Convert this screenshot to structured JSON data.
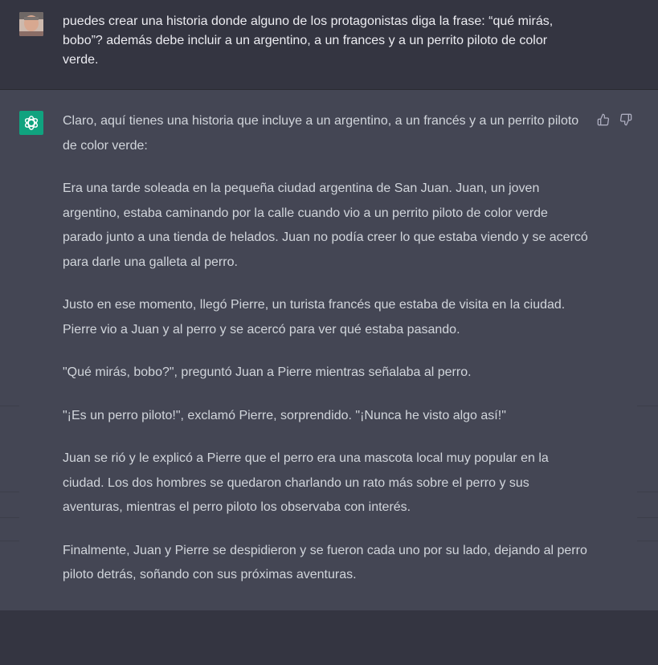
{
  "user_message": {
    "avatar_icon": "user-photo",
    "text": "puedes crear una historia donde alguno de los protagonistas diga la frase: “qué mirás, bobo”? además debe incluir a un argentino, a un frances y a un perrito piloto de color verde."
  },
  "assistant_message": {
    "avatar_icon": "openai-logo",
    "avatar_color": "#10a37f",
    "paragraphs": [
      "Claro, aquí tienes una historia que incluye a un argentino, a un francés y a un perrito piloto de color verde:",
      "Era una tarde soleada en la pequeña ciudad argentina de San Juan. Juan, un joven argentino, estaba caminando por la calle cuando vio a un perrito piloto de color verde parado junto a una tienda de helados. Juan no podía creer lo que estaba viendo y se acercó para darle una galleta al perro.",
      "Justo en ese momento, llegó Pierre, un turista francés que estaba de visita en la ciudad. Pierre vio a Juan y al perro y se acercó para ver qué estaba pasando.",
      "\"Qué mirás, bobo?\", preguntó Juan a Pierre mientras señalaba al perro.",
      "\"¡Es un perro piloto!\", exclamó Pierre, sorprendido. \"¡Nunca he visto algo así!\"",
      "Juan se rió y le explicó a Pierre que el perro era una mascota local muy popular en la ciudad. Los dos hombres se quedaron charlando un rato más sobre el perro y sus aventuras, mientras el perro piloto los observaba con interés.",
      "Finalmente, Juan y Pierre se despidieron y se fueron cada uno por su lado, dejando al perro piloto detrás, soñando con sus próximas aventuras."
    ],
    "feedback": {
      "thumbs_up_icon": "thumbs-up-icon",
      "thumbs_down_icon": "thumbs-down-icon"
    }
  },
  "colors": {
    "background": "#343541",
    "assistant_background": "#444654",
    "text": "#d1d5db"
  }
}
